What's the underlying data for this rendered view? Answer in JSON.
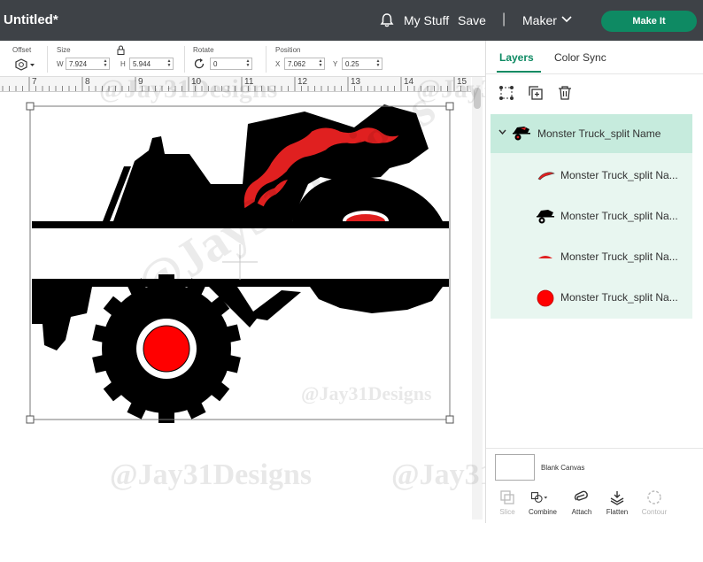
{
  "header": {
    "title": "Untitled*",
    "my_stuff": "My Stuff",
    "save": "Save",
    "separator": "|",
    "machine": "Maker",
    "make_it": "Make It"
  },
  "toolbar": {
    "offset_label": "Offset",
    "size_label": "Size",
    "w_label": "W",
    "w_value": "7.924",
    "h_label": "H",
    "h_value": "5.944",
    "rotate_label": "Rotate",
    "rotate_value": "0",
    "position_label": "Position",
    "x_label": "X",
    "x_value": "7.062",
    "y_label": "Y",
    "y_value": "0.25"
  },
  "ruler": {
    "ticks": [
      "7",
      "8",
      "9",
      "10",
      "11",
      "12",
      "13",
      "14",
      "15"
    ]
  },
  "panel": {
    "tabs": [
      "Layers",
      "Color Sync"
    ],
    "active_tab": "Layers",
    "group": {
      "name": "Monster Truck_split Name",
      "expanded": true
    },
    "layers": [
      {
        "name": "Monster Truck_split Na...",
        "icon": "red-flame-layer-icon"
      },
      {
        "name": "Monster Truck_split Na...",
        "icon": "truck-layer-icon"
      },
      {
        "name": "Monster Truck_split Na...",
        "icon": "red-arc-layer-icon"
      },
      {
        "name": "Monster Truck_split Na...",
        "icon": "red-circle-layer-icon"
      }
    ],
    "blank_canvas": "Blank Canvas",
    "actions": [
      {
        "label": "Slice",
        "enabled": false
      },
      {
        "label": "Combine",
        "enabled": true
      },
      {
        "label": "Attach",
        "enabled": true
      },
      {
        "label": "Flatten",
        "enabled": true
      },
      {
        "label": "Contour",
        "enabled": false
      }
    ]
  },
  "watermark": {
    "text": "@Jay31Designs"
  },
  "colors": {
    "topbar": "#3e4247",
    "accent": "#0e8a63",
    "layer_bg": "#e8f6f0",
    "group_bg": "#c6ebdd",
    "flame_red": "#e02020"
  }
}
